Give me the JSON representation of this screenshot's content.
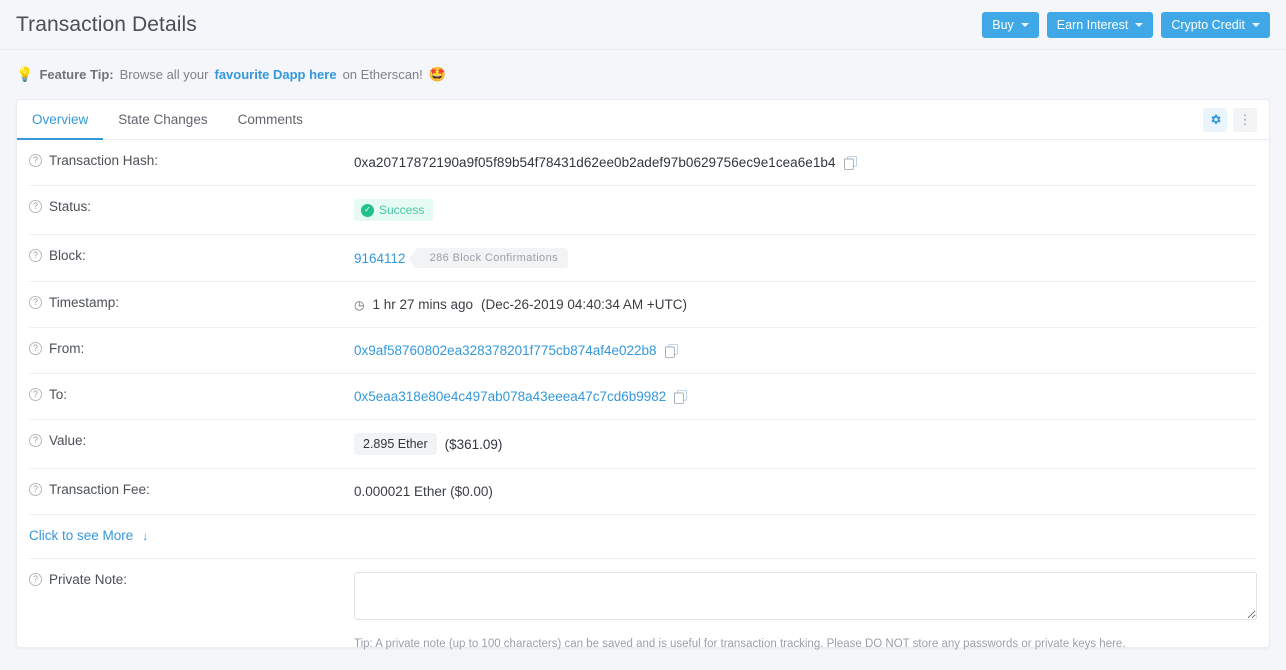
{
  "header": {
    "title": "Transaction Details",
    "actions": [
      {
        "label": "Buy",
        "icon": "chevron-down-icon"
      },
      {
        "label": "Earn Interest",
        "icon": "chevron-down-icon"
      },
      {
        "label": "Crypto Credit",
        "icon": "chevron-down-icon"
      }
    ],
    "accent_color": "#41a8e8"
  },
  "feature_tip": {
    "bulb_icon": "💡",
    "strong": "Feature Tip:",
    "text_before": "Browse all your",
    "link": "favourite Dapp here",
    "text_after": "on Etherscan!",
    "emoji": "🤩"
  },
  "tabs": [
    {
      "label": "Overview",
      "active": true
    },
    {
      "label": "State Changes",
      "active": false
    },
    {
      "label": "Comments",
      "active": false
    }
  ],
  "tab_icons": {
    "gear": "gear-icon",
    "dots": "⋮"
  },
  "overview": {
    "labels": {
      "transaction_hash": "Transaction Hash:",
      "status": "Status:",
      "block": "Block:",
      "timestamp": "Timestamp:",
      "from": "From:",
      "to": "To:",
      "value": "Value:",
      "transaction_fee": "Transaction Fee:",
      "private_note": "Private Note:"
    },
    "transaction_hash": "0xa20717872190a9f05f89b54f78431d62ee0b2adef97b0629756ec9e1cea6e1b4",
    "status": "Success",
    "status_color": "#23c08a",
    "block_number": "9164112",
    "block_confirmations": "286 Block Confirmations",
    "timestamp_relative": "1 hr 27 mins ago",
    "timestamp_absolute": "(Dec-26-2019 04:40:34 AM +UTC)",
    "clock_icon": "◷",
    "from_address": "0x9af58760802ea328378201f775cb874af4e022b8",
    "to_address": "0x5eaa318e80e4c497ab078a43eeea47c7cd6b9982",
    "value_ether": "2.895 Ether",
    "value_usd": "($361.09)",
    "transaction_fee": "0.000021 Ether ($0.00)",
    "see_more": "Click to see More",
    "see_more_arrow": "↓",
    "private_note_value": "",
    "private_note_placeholder": "",
    "private_note_tip": "Tip: A private note (up to 100 characters) can be saved and is useful for transaction tracking. Please DO NOT store any passwords or private keys here.",
    "help_icon": "?"
  }
}
